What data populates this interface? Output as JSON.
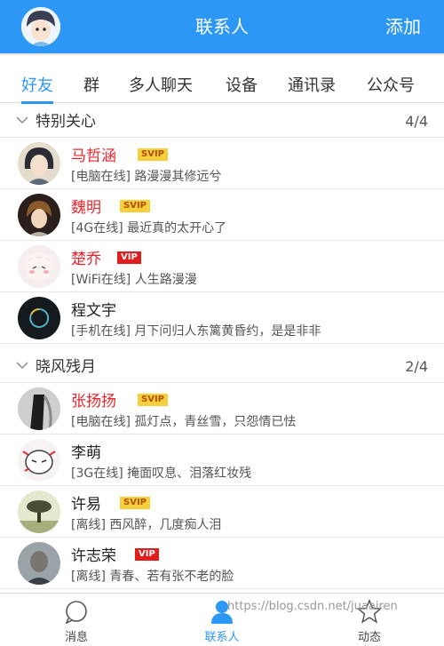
{
  "header": {
    "title": "联系人",
    "add_label": "添加"
  },
  "tabs": [
    "好友",
    "群",
    "多人聊天",
    "设备",
    "通讯录",
    "公众号"
  ],
  "groups": [
    {
      "name": "特别关心",
      "count": "4/4",
      "contacts": [
        {
          "name": "马哲涵",
          "badge": "SVIP",
          "status": "[电脑在线] 路漫漫其修远兮"
        },
        {
          "name": "魏明",
          "badge": "SVIP",
          "status": "[4G在线] 最近真的太开心了"
        },
        {
          "name": "楚乔",
          "badge": "VIP",
          "status": "[WiFi在线] 人生路漫漫"
        },
        {
          "name": "程文宇",
          "badge": "",
          "status": "[手机在线] 月下问归人东篱黄昏约，是是非非"
        }
      ]
    },
    {
      "name": "晓风残月",
      "count": "2/4",
      "contacts": [
        {
          "name": "张扬扬",
          "badge": "SVIP",
          "status": "[电脑在线] 孤灯点，青丝雪，只怨情已怯"
        },
        {
          "name": "李萌",
          "badge": "",
          "status": "[3G在线] 掩面叹息、泪落红妆残"
        },
        {
          "name": "许易",
          "badge": "SVIP",
          "status": "[离线] 西风醉，几度痴人泪"
        },
        {
          "name": "许志荣",
          "badge": "VIP",
          "status": "[离线] 青春、若有张不老的脸"
        }
      ]
    }
  ],
  "bottom_nav": [
    {
      "label": "消息",
      "icon": "message-icon"
    },
    {
      "label": "联系人",
      "icon": "contacts-icon"
    },
    {
      "label": "动态",
      "icon": "star-icon"
    }
  ],
  "watermark": "https://blog.csdn.net/juaairen",
  "colors": {
    "primary": "#2d97f5",
    "vip_red": "#e8242b",
    "svip_gold": "#f5cf3c"
  }
}
